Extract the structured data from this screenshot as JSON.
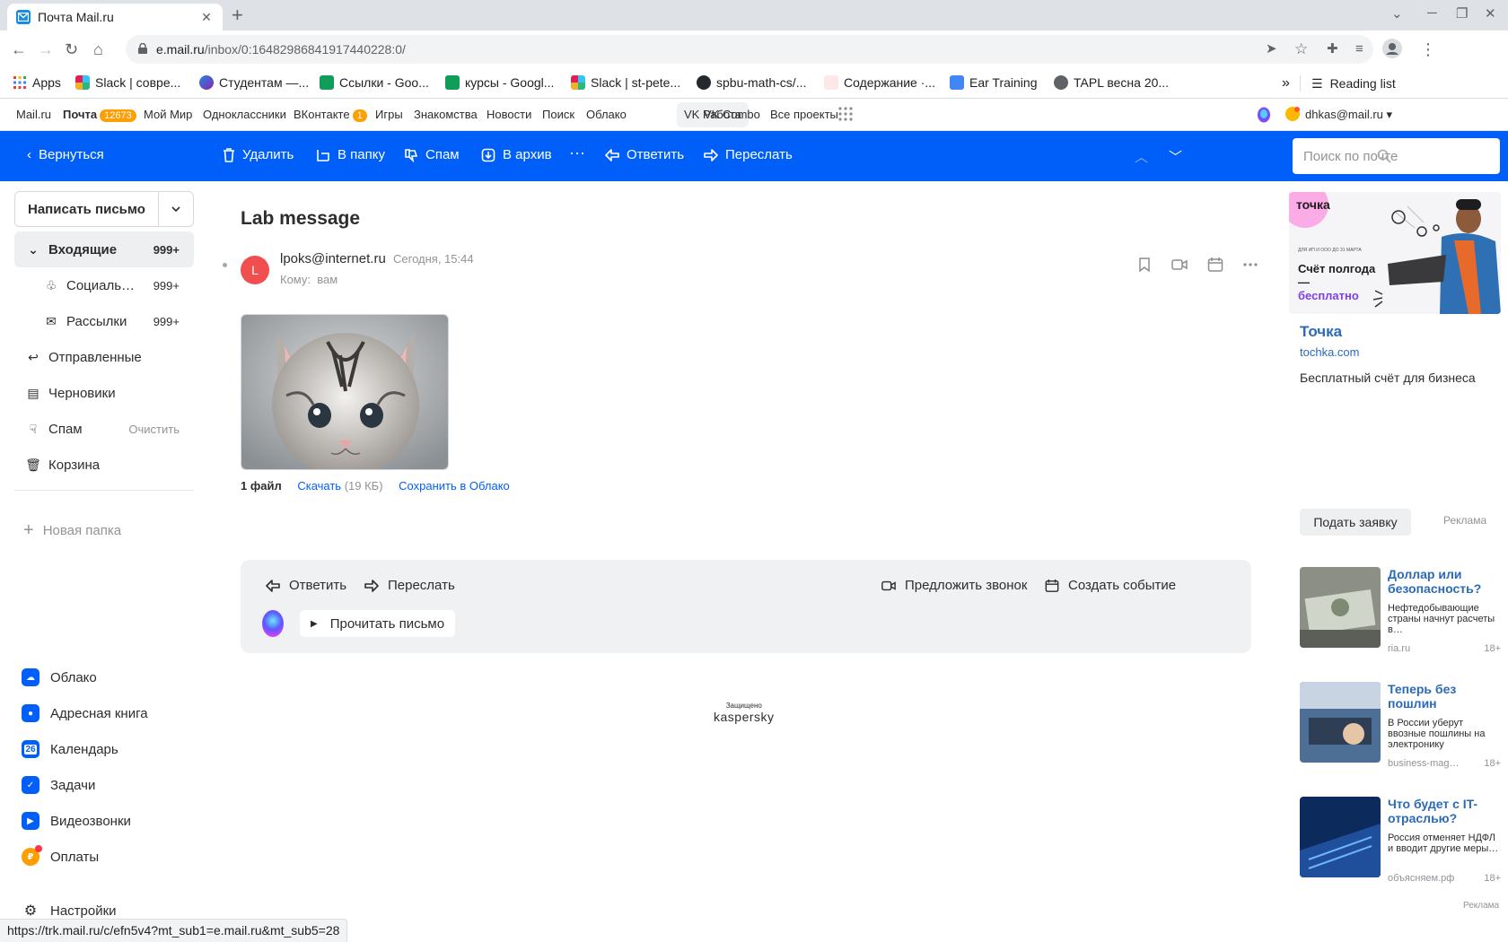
{
  "browser": {
    "tab_title": "Почта Mail.ru",
    "url_host": "e.mail.ru",
    "url_path": "/inbox/0:16482986841917440228:0/",
    "bookmarks": [
      "Apps",
      "Slack | совре...",
      "Студентам —...",
      "Ссылки - Goo...",
      "курсы - Googl...",
      "Slack | st-pete...",
      "spbu-math-cs/...",
      "Содержание ·...",
      "Ear Training",
      "TAPL весна 20..."
    ],
    "reading_list": "Reading list",
    "status_url": "https://trk.mail.ru/c/efn5v4?mt_sub1=e.mail.ru&mt_sub5=28"
  },
  "portal": {
    "items": [
      "Mail.ru",
      "Почта",
      "Мой Мир",
      "Одноклассники",
      "ВКонтакте",
      "Игры",
      "Знакомства",
      "Новости",
      "Поиск",
      "Облако",
      "VK Работа",
      "VK Combo",
      "Все проекты"
    ],
    "mail_badge": "12673",
    "vk_badge": "1",
    "user": "dhkas@mail.ru"
  },
  "toolbar": {
    "back": "Вернуться",
    "delete": "Удалить",
    "to_folder": "В папку",
    "spam": "Спам",
    "archive": "В архив",
    "more": "···",
    "reply": "Ответить",
    "forward": "Переслать",
    "search_placeholder": "Поиск по почте"
  },
  "sidebar": {
    "compose": "Написать письмо",
    "folders": [
      {
        "label": "Входящие",
        "count": "999+"
      },
      {
        "label": "Социаль…",
        "count": "999+"
      },
      {
        "label": "Рассылки",
        "count": "999+"
      },
      {
        "label": "Отправленные",
        "count": ""
      },
      {
        "label": "Черновики",
        "count": ""
      },
      {
        "label": "Спам",
        "count": "Очистить"
      },
      {
        "label": "Корзина",
        "count": ""
      }
    ],
    "new_folder": "Новая папка",
    "services": [
      "Облако",
      "Адресная книга",
      "Календарь",
      "Задачи",
      "Видеозвонки",
      "Оплаты",
      "Настройки"
    ],
    "calendar_day": "26"
  },
  "letter": {
    "subject": "Lab message",
    "avatar_letter": "L",
    "sender": "lpoks@internet.ru",
    "date": "Сегодня, 15:44",
    "to_label": "Кому:",
    "to_value": "вам",
    "files_count": "1 файл",
    "download": "Скачать",
    "size": "(19 КБ)",
    "save_cloud": "Сохранить в Облако",
    "actions": {
      "reply": "Ответить",
      "forward": "Переслать",
      "call": "Предложить звонок",
      "event": "Создать событие",
      "read": "Прочитать письмо"
    },
    "protected": "Защищено",
    "kaspersky": "kaspersky"
  },
  "ads": {
    "banner_brand": "точка",
    "banner_small": "ДЛЯ ИП И ООО ДО 31 МАРТА",
    "banner_text1": "Счёт полгода —",
    "banner_text2": "бесплатно",
    "title": "Точка",
    "domain": "tochka.com",
    "desc": "Бесплатный счёт для бизнеса",
    "button": "Подать заявку",
    "label": "Реклама",
    "news": [
      {
        "title": "Доллар или безопасность?",
        "desc": "Нефтедобывающие страны начнут расчеты в…",
        "source": "ria.ru",
        "age": "18+"
      },
      {
        "title": "Теперь без пошлин",
        "desc": "В России уберут ввозные пошлины на электронику",
        "source": "business-mag…",
        "age": "18+"
      },
      {
        "title": "Что будет с IT-отраслью?",
        "desc": "Россия отменяет НДФЛ и вводит другие меры…",
        "source": "объясняем.рф",
        "age": "18+"
      }
    ],
    "label2": "Реклама"
  }
}
